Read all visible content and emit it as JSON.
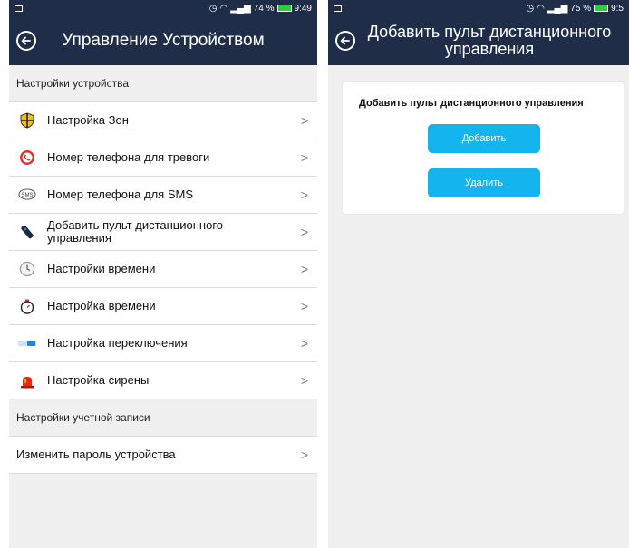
{
  "left": {
    "status": {
      "time": "9:49",
      "battery": "74 %"
    },
    "title": "Управление Устройством",
    "section1": "Настройки устройства",
    "items": [
      {
        "label": "Настройка Зон",
        "icon": "zone-shield-icon"
      },
      {
        "label": "Номер телефона для тревоги",
        "icon": "phone-icon"
      },
      {
        "label": "Номер телефона для SMS",
        "icon": "sms-icon"
      },
      {
        "label": "Добавить пульт дистанционного управления",
        "icon": "remote-control-icon"
      },
      {
        "label": "Настройки времени",
        "icon": "clock-icon"
      },
      {
        "label": "Настройка времени",
        "icon": "timer-icon"
      },
      {
        "label": "Настройка переключения",
        "icon": "switch-icon"
      },
      {
        "label": "Настройка сирены",
        "icon": "siren-icon"
      }
    ],
    "section2": "Настройки учетной записи",
    "account_item": "Изменить пароль устройства"
  },
  "right": {
    "status": {
      "time": "9:5",
      "battery": "75 %"
    },
    "title": "Добавить пульт дистанционного управления",
    "card_title": "Добавить пульт дистанционного управления",
    "add_label": "Добавить",
    "delete_label": "Удалить"
  },
  "colors": {
    "header": "#1f2d49",
    "accent": "#14b4ee",
    "background": "#f0f0f0"
  }
}
